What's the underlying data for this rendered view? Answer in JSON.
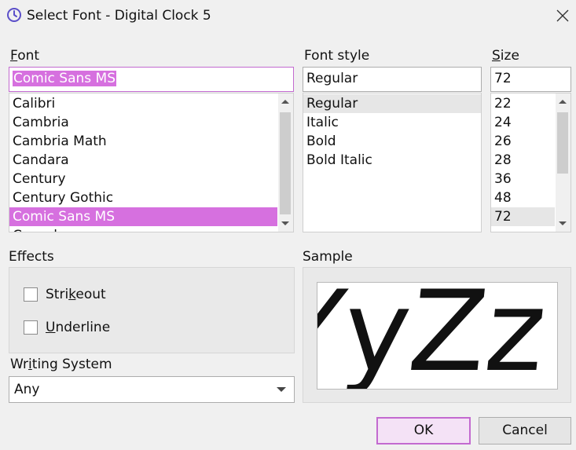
{
  "window": {
    "title": "Select Font - Digital Clock 5",
    "icon": "clock-icon",
    "close_icon": "close-icon"
  },
  "font": {
    "label_pre": "",
    "label_accel": "F",
    "label_post": "ont",
    "value": "Comic Sans MS",
    "items": [
      "Calibri",
      "Cambria",
      "Cambria Math",
      "Candara",
      "Century",
      "Century Gothic",
      "Comic Sans MS",
      "Consolas"
    ],
    "selected_index": 6
  },
  "style": {
    "label": "Font style",
    "value": "Regular",
    "items": [
      "Regular",
      "Italic",
      "Bold",
      "Bold Italic"
    ],
    "current_index": 0
  },
  "size": {
    "label_pre": "",
    "label_accel": "S",
    "label_post": "ize",
    "value": "72",
    "items": [
      "22",
      "24",
      "26",
      "28",
      "36",
      "48",
      "72"
    ],
    "current_index": 6
  },
  "effects": {
    "label": "Effects",
    "strikeout": {
      "pre": "Stri",
      "accel": "k",
      "post": "eout",
      "checked": false
    },
    "underline": {
      "pre": "",
      "accel": "U",
      "post": "nderline",
      "checked": false
    }
  },
  "writing_system": {
    "label_pre": "Wr",
    "label_accel": "i",
    "label_post": "ting System",
    "value": "Any"
  },
  "sample": {
    "label": "Sample",
    "text": "YyZz"
  },
  "buttons": {
    "ok": "OK",
    "cancel": "Cancel"
  },
  "colors": {
    "accent": "#d670df",
    "accent_border": "#c36ad0"
  }
}
